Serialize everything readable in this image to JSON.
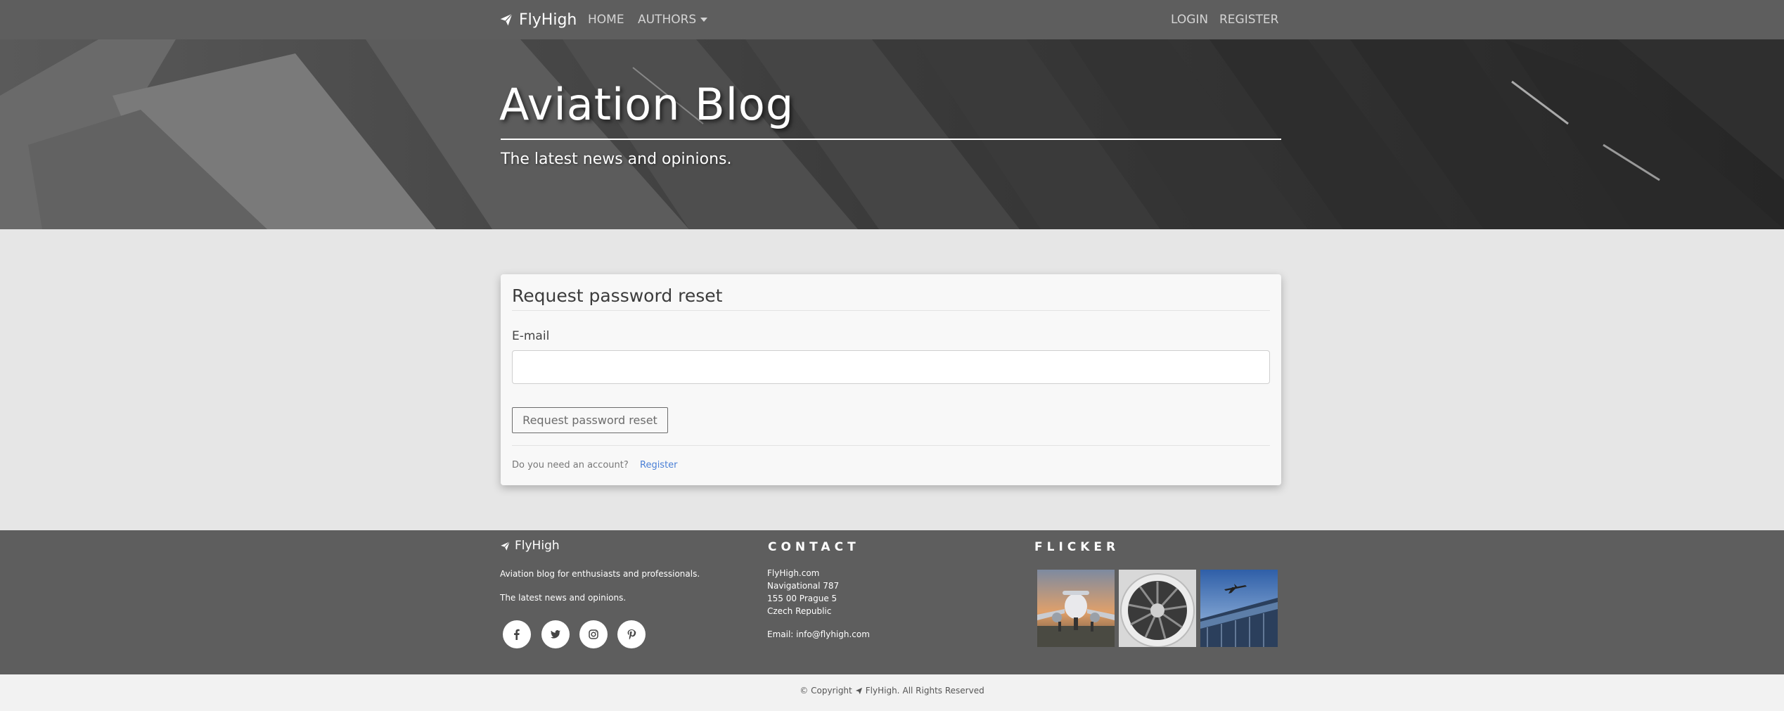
{
  "navbar": {
    "brand": "FlyHigh",
    "brand_icon": "paper-plane-icon",
    "home": "HOME",
    "authors": "AUTHORS",
    "login": "LOGIN",
    "register": "REGISTER"
  },
  "hero": {
    "title": "Aviation Blog",
    "subtitle": "The latest news and opinions."
  },
  "form": {
    "title": "Request password reset",
    "email_label": "E-mail",
    "email_value": "",
    "submit_label": "Request password reset",
    "account_question": "Do you need an account?",
    "register_link": "Register",
    "link_color": "#4a7fd6"
  },
  "footer": {
    "brand": "FlyHigh",
    "description": "Aviation blog for enthusiasts and professionals.",
    "tagline": "The latest news and opinions.",
    "social_icons": [
      "facebook-icon",
      "twitter-icon",
      "instagram-icon",
      "pinterest-icon"
    ],
    "contact_heading": "CONTACT",
    "contact_lines": [
      "FlyHigh.com",
      "Navigational 787",
      "155 00 Prague 5",
      "Czech Republic"
    ],
    "email_line": "Email: info@flyhigh.com",
    "flicker_heading": "FLICKER",
    "flicker_images": [
      "airplane-front-image",
      "jet-engine-image",
      "airport-plane-image"
    ],
    "background_color": "#5e5e5e"
  },
  "copyright": {
    "prefix": "© Copyright",
    "brand": "FlyHigh.",
    "suffix": "All Rights Reserved"
  }
}
